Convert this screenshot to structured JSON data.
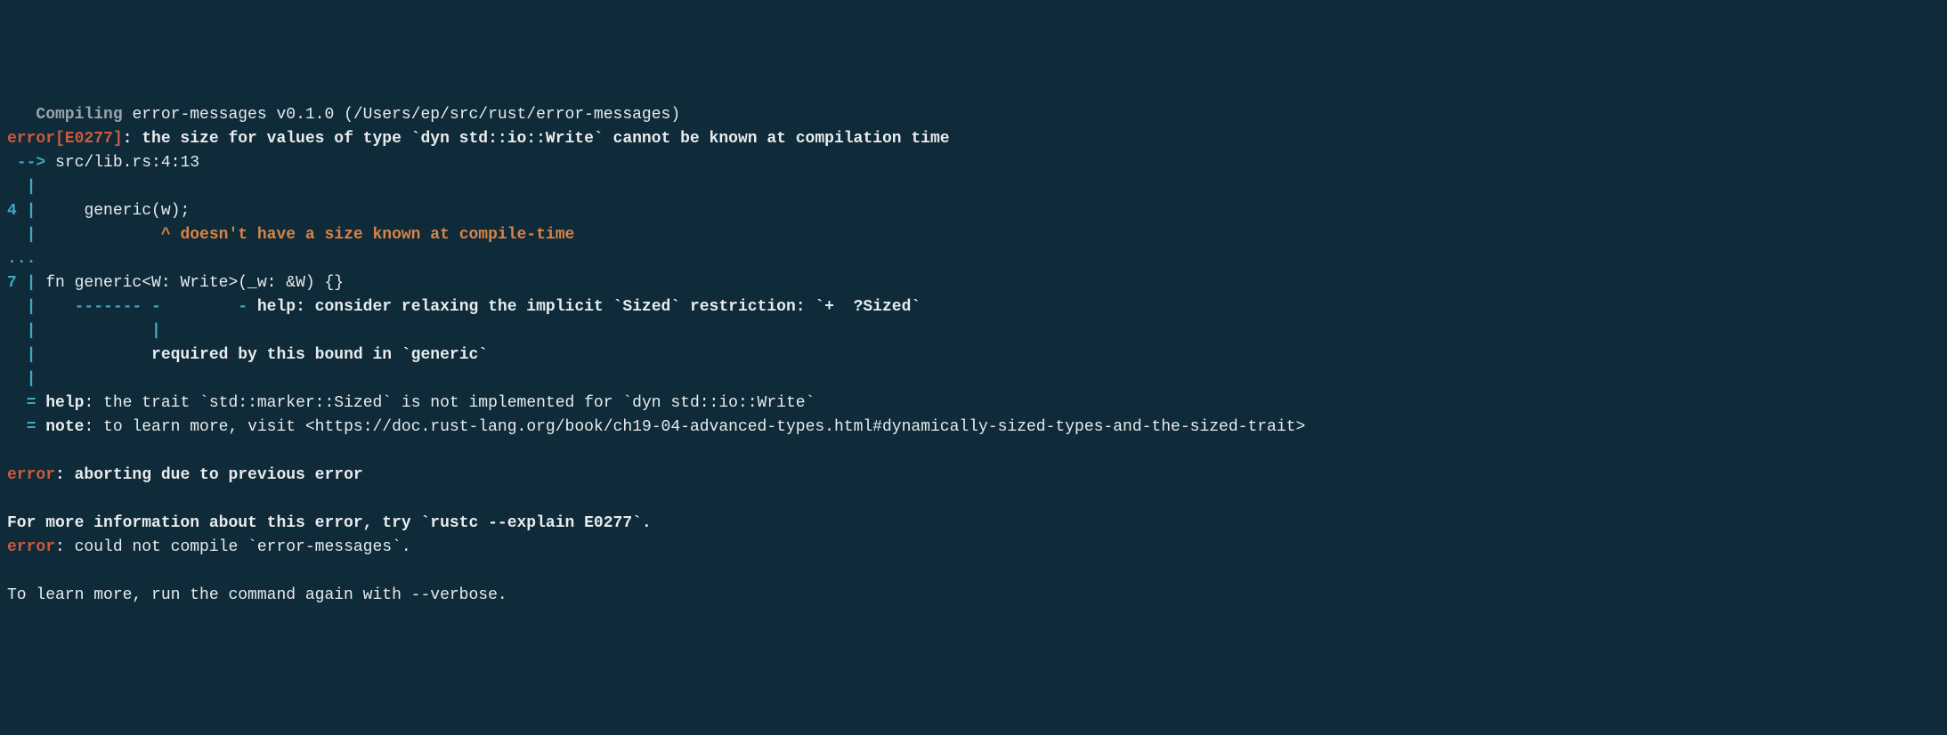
{
  "compiling": {
    "label": "Compiling",
    "package": "error-messages v0.1.0 (/Users/ep/src/rust/error-messages)"
  },
  "error_header": {
    "error_code": "error[E0277]",
    "message": ": the size for values of type `dyn std::io::Write` cannot be known at compilation time"
  },
  "location": {
    "arrow": " --> ",
    "path": "src/lib.rs:4:13"
  },
  "gutter": {
    "empty_pipe": "  |",
    "line4_num": "4",
    "line4_pipe": " |     ",
    "line4_code": "generic(w);",
    "line4_caret_pipe": "  |             ",
    "line4_caret": "^ ",
    "line4_caret_msg": "doesn't have a size known at compile-time",
    "ellipsis": "...",
    "line7_num": "7",
    "line7_pipe": " | ",
    "line7_code": "fn generic<W: Write>(_w: &W) {}",
    "line7_under_pipe": "  |    ",
    "line7_under_dashes": "------- -        - ",
    "line7_help": "help: consider relaxing the implicit `Sized` restriction: `+  ?Sized`",
    "line7_bar2_pipe": "  |            ",
    "line7_bar2": "|",
    "line7_req_pipe": "  |            ",
    "line7_req_msg": "required by this bound in `generic`",
    "final_empty_pipe": "  |"
  },
  "help": {
    "eq": "  = ",
    "help_label": "help",
    "help_text": ": the trait `std::marker::Sized` is not implemented for `dyn std::io::Write`"
  },
  "note": {
    "eq": "  = ",
    "note_label": "note",
    "note_text": ": to learn more, visit <https://doc.rust-lang.org/book/ch19-04-advanced-types.html#dynamically-sized-types-and-the-sized-trait>"
  },
  "abort": {
    "error_label": "error",
    "abort_msg": ": aborting due to previous error"
  },
  "more_info": "For more information about this error, try `rustc --explain E0277`.",
  "compile_fail": {
    "error_label": "error",
    "fail_msg": ": could not compile `error-messages`."
  },
  "learn_more": "To learn more, run the command again with --verbose."
}
